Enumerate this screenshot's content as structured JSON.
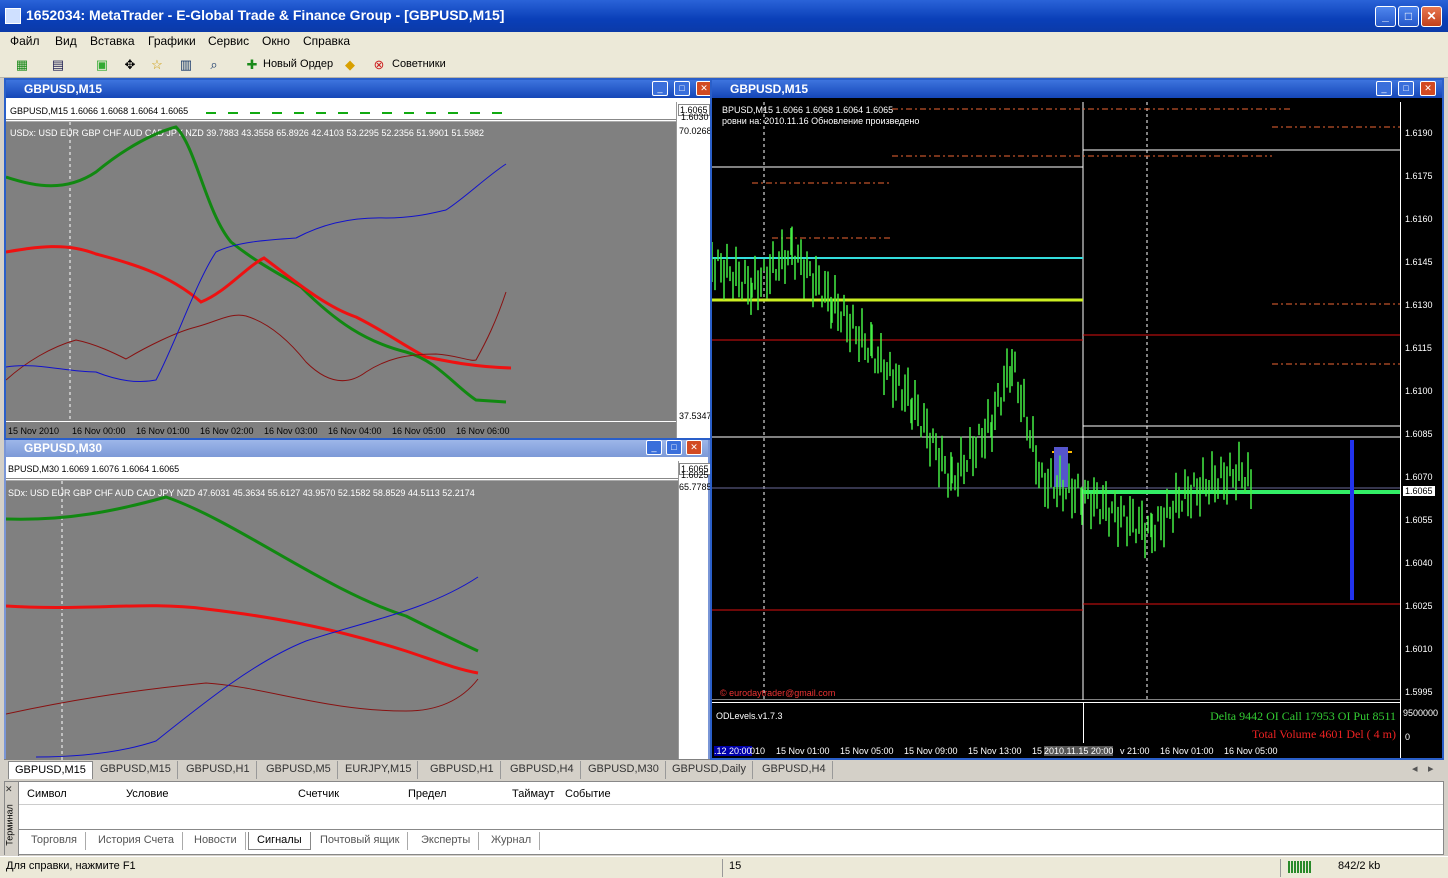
{
  "app": {
    "title": "1652034: MetaTrader - E-Global Trade & Finance Group - [GBPUSD,M15]"
  },
  "menu": [
    "Файл",
    "Вид",
    "Вставка",
    "Графики",
    "Сервис",
    "Окно",
    "Справка"
  ],
  "toolbar": {
    "new_order": "Новый Ордер",
    "experts": "Советники"
  },
  "chart_left_top": {
    "title": "GBPUSD,M15",
    "header": "GBPUSD,M15  1.6066 1.6068 1.6064 1.6065",
    "price_tag": "1.6065",
    "price_2": "1.6030",
    "indicator": "USDx: USD EUR GBP CHF AUD CAD JPY NZD 39.7883 43.3558 65.8926 42.4103 53.2295 52.2356 51.9901 51.5982",
    "axis_top": "70.0268",
    "axis_bottom": "37.5347",
    "time_labels": [
      "15 Nov 2010",
      "16 Nov 00:00",
      "16 Nov 01:00",
      "16 Nov 02:00",
      "16 Nov 03:00",
      "16 Nov 04:00",
      "16 Nov 05:00",
      "16 Nov 06:00"
    ]
  },
  "chart_left_bottom": {
    "title": "GBPUSD,M30",
    "header": "BPUSD,M30  1.6069 1.6076 1.6064 1.6065",
    "price_tag": "1.6065",
    "price_2": "1.6025",
    "axis_top": "65.7785",
    "indicator": "SDx: USD EUR GBP CHF AUD CAD JPY NZD 47.6031 45.3634 55.6127 43.9570 52.1582 58.8529 44.5113 52.2174"
  },
  "chart_right": {
    "title": "GBPUSD,M15",
    "header": "BPUSD,M15  1.6066 1.6068 1.6064 1.6065",
    "subheader": "ровни на: 2010.11.16 Обновление произведено",
    "email": "© eurodaytrader@gmail.com",
    "odlevels": "ODLevels.v1.7.3",
    "delta": "Delta 9442 OI Call 17953 OI Put 8511",
    "volume": "Total Volume 4601 Del ( 4 m)",
    "price_tag": "1.6065",
    "axis": [
      "1.6190",
      "1.6175",
      "1.6160",
      "1.6145",
      "1.6130",
      "1.6115",
      "1.6100",
      "1.6085",
      "1.6070",
      "1.6055",
      "1.6040",
      "1.6025",
      "1.6010",
      "1.5995",
      "9500000",
      "0"
    ],
    "time_labels": [
      ".12 20:00",
      "010",
      "15 Nov 01:00",
      "15 Nov 05:00",
      "15 Nov 09:00",
      "15 Nov 13:00",
      "15",
      "2010.11.15 20:00",
      "v 21:00",
      "16 Nov 01:00",
      "16 Nov 05:00"
    ]
  },
  "chart_tabs": [
    "GBPUSD,M15",
    "GBPUSD,M15",
    "GBPUSD,H1",
    "GBPUSD,M5",
    "EURJPY,M15",
    "GBPUSD,H1",
    "GBPUSD,H4",
    "GBPUSD,M30",
    "GBPUSD,Daily",
    "GBPUSD,H4"
  ],
  "terminal": {
    "side_label": "Терминал",
    "columns": [
      "Символ",
      "Условие",
      "Счетчик",
      "Предел",
      "Таймаут",
      "Событие"
    ],
    "tabs": [
      "Торговля",
      "История Счета",
      "Новости",
      "Сигналы",
      "Почтовый ящик",
      "Эксперты",
      "Журнал"
    ],
    "active_tab": "Сигналы"
  },
  "status": {
    "help": "Для справки, нажмите F1",
    "count": "15",
    "traffic": "842/2 kb"
  }
}
